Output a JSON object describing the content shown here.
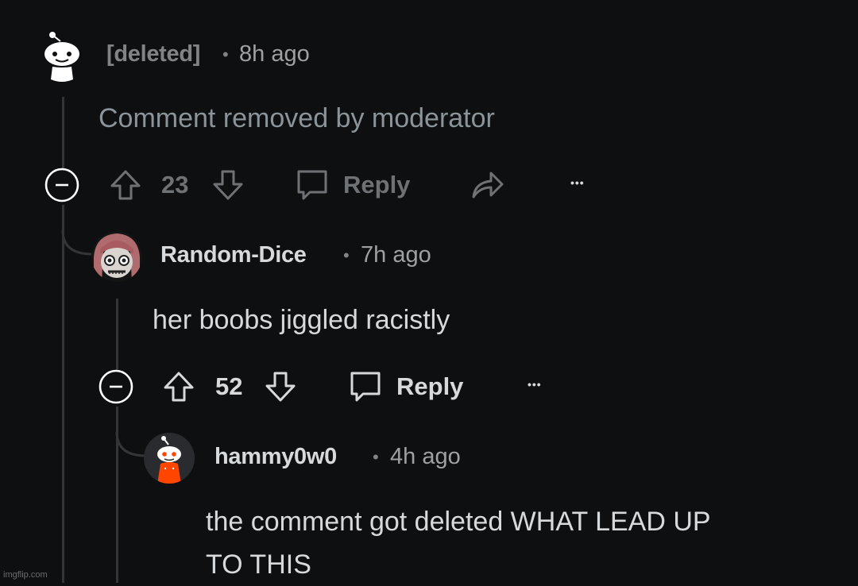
{
  "thread": {
    "comments": [
      {
        "username": "[deleted]",
        "separator": "•",
        "time": "8h ago",
        "body": "Comment removed by moderator",
        "votes": "23",
        "reply_label": "Reply",
        "more_label": "•••",
        "avatar": "deleted-snoo-icon",
        "style": "dimmed"
      },
      {
        "username": "Random-Dice",
        "separator": "•",
        "time": "7h ago",
        "body": "her boobs jiggled racistly",
        "votes": "52",
        "reply_label": "Reply",
        "more_label": "•••",
        "avatar": "anime-avatar-icon",
        "style": "normal"
      },
      {
        "username": "hammy0w0",
        "separator": "•",
        "time": "4h ago",
        "body_lines": [
          "the comment got deleted WHAT LEAD UP",
          "TO THIS"
        ],
        "avatar": "snoo-avatar-icon",
        "style": "normal"
      }
    ]
  },
  "watermark": "imgflip.com",
  "colors": {
    "background": "#0e0f11",
    "text": "#d7dadc",
    "dim_text": "#6f7275",
    "thread_line": "#343536",
    "snoo_orange": "#ff4500"
  }
}
